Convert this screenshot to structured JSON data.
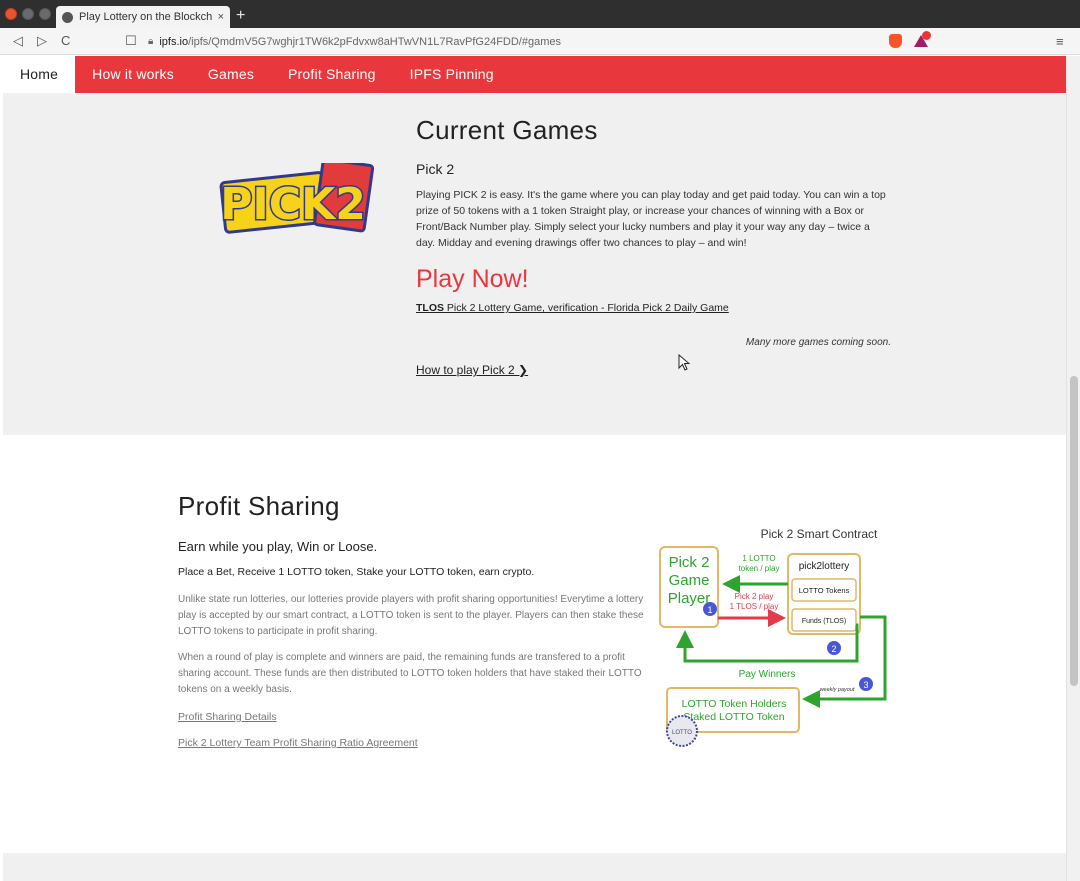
{
  "browser": {
    "tab_title": "Play Lottery on the Blockch",
    "tab_close": "×",
    "new_tab": "+",
    "url_host": "ipfs.io",
    "url_rest": "/ipfs/QmdmV5G7wghjr1TW6k2pFdvxw8aHTwVN1L7RavPfG24FDD/#games",
    "nav_back": "◁",
    "nav_forward": "▷",
    "nav_reload": "C",
    "bookmark": "☐",
    "menu": "≡"
  },
  "nav": {
    "items": [
      "Home",
      "How it works",
      "Games",
      "Profit Sharing",
      "IPFS Pinning"
    ],
    "active": "Home"
  },
  "games": {
    "logo_text": "PICK2",
    "title": "Current Games",
    "game_name": "Pick 2",
    "description": "Playing PICK 2 is easy. It's the game where you can play today and get paid today. You can win a top prize of 50 tokens with a 1 token Straight play, or increase your chances of winning with a Box or Front/Back Number play. Simply select your lucky numbers and play it your way any day – twice a day. Midday and evening drawings offer two chances to play – and win!",
    "play_now": "Play Now!",
    "tlos_bold": "TLOS",
    "tlos_rest": " Pick 2 Lottery Game, verification - Florida Pick 2 Daily Game",
    "coming_soon": "Many more games coming soon.",
    "howto": "How to play Pick 2 ❯"
  },
  "profit": {
    "title": "Profit Sharing",
    "subtitle": "Earn while you play, Win or Loose.",
    "bold_line": "Place a Bet, Receive 1 LOTTO token, Stake your LOTTO token, earn crypto.",
    "p1": "Unlike state run lotteries, our lotteries provide players with profit sharing opportunities! Everytime a lottery play is accepted by our smart contract, a LOTTO token is sent to the player. Players can then stake these LOTTO tokens to participate in profit sharing.",
    "p2": "When a round of play is complete and winners are paid, the remaining funds are transfered to a profit sharing account. These funds are then distributed to LOTTO token holders that have staked their LOTTO tokens on a weekly basis.",
    "link1": "Profit Sharing Details",
    "link2": "Pick 2 Lottery Team Profit Sharing Ratio Agreement"
  },
  "diagram": {
    "title": "Pick 2 Smart Contract",
    "player_line1": "Pick 2",
    "player_line2": "Game",
    "player_line3": "Player",
    "contract": "pick2lottery",
    "tokens_box": "LOTTO Tokens",
    "funds_box": "Funds (TLOS)",
    "arrow1_line1": "1 LOTTO",
    "arrow1_line2": "token / play",
    "arrow2_line1": "Pick 2 play",
    "arrow2_line2": "1 TLOS / play",
    "pay_winners": "Pay Winners",
    "weekly_payout": "weekly payout",
    "holders_line1": "LOTTO Token Holders",
    "holders_line2": "Staked LOTTO Token",
    "coin": "LOTTO",
    "step1": "1",
    "step2": "2",
    "step3": "3",
    "colors": {
      "green": "#2ea32e",
      "red": "#e23b4a",
      "box_border": "#e3b766",
      "step": "#4a56d8"
    }
  }
}
